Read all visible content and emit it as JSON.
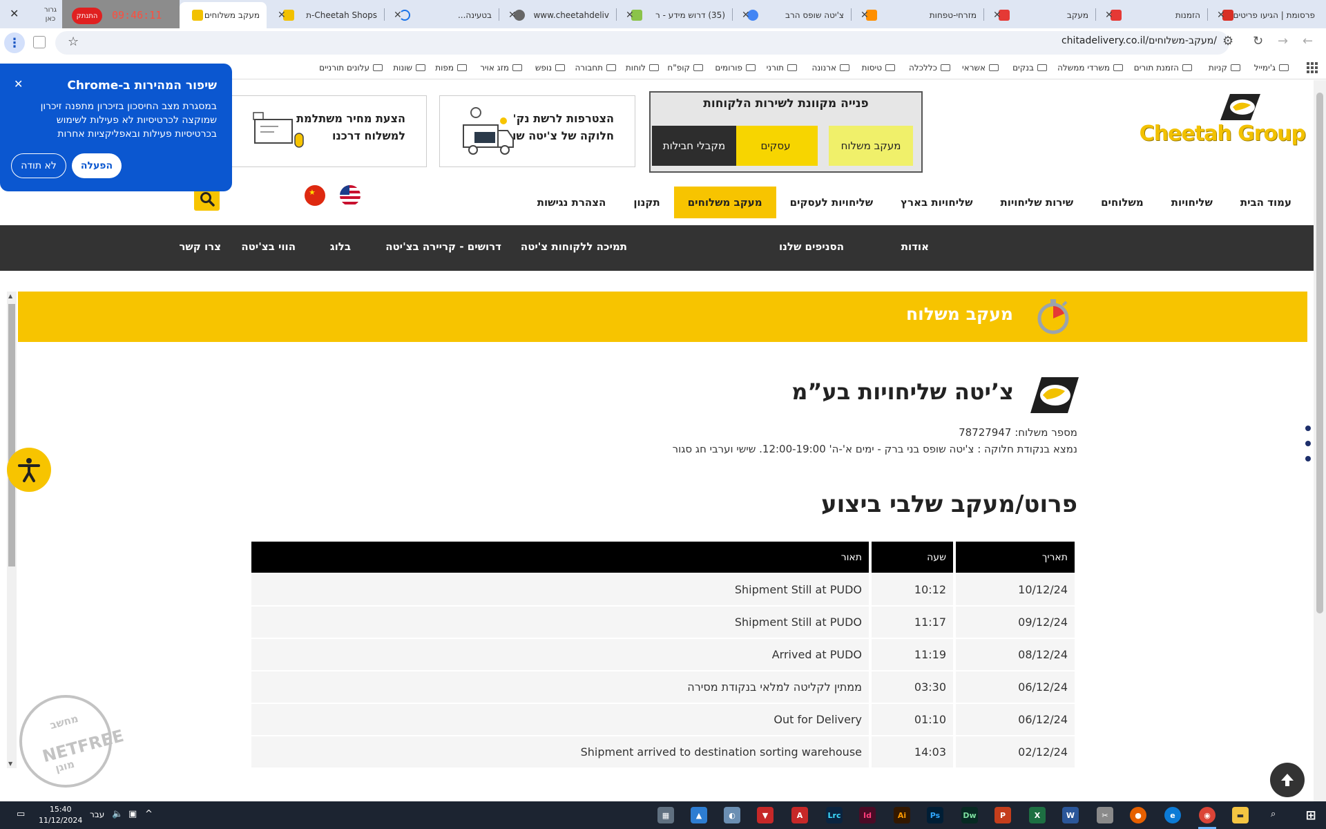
{
  "browser": {
    "tabs": [
      {
        "title": "פרסומת | הגיעו פריטים",
        "favicon_color": "#d93025",
        "favicon": "gmail-icon"
      },
      {
        "title": "הזמנות",
        "favicon_color": "#e53935",
        "favicon": "orders-icon"
      },
      {
        "title": "מעקב",
        "favicon_color": "#e53935",
        "favicon": "tracking-icon"
      },
      {
        "title": "מזרחי-טפחות",
        "favicon_color": "#ff8f00",
        "favicon": "bank-icon"
      },
      {
        "title": "צ'יטה שופס הרב",
        "favicon_color": "#4285f4",
        "favicon": "google-icon"
      },
      {
        "title": "(35) דרוש מידע - ר",
        "favicon_color": "#8bc34a",
        "favicon": "forum-icon"
      },
      {
        "title": "www.cheetahdeliv",
        "favicon_color": "#666666",
        "favicon": "globe-icon"
      },
      {
        "title": "בטעינה...",
        "favicon_color": "#1a73e8",
        "favicon": "loading-icon"
      },
      {
        "title": "Cheetah Shops-ת",
        "favicon_color": "#f2c100",
        "favicon": "cheetah-icon"
      },
      {
        "title": "מעקב משלוחים -",
        "favicon_color": "#f2c100",
        "favicon": "cheetah-icon",
        "active": true
      }
    ],
    "recorder": {
      "time": "09:46:11",
      "stop_label": "התנתק",
      "side_label": "גרור כאן"
    },
    "url": "chitadelivery.co.il/מעקב-משלוחים/",
    "bookmarks": [
      "ג'ימייל",
      "קניות",
      "הזמנת תורים",
      "משרדי ממשלה",
      "בנקים",
      "אשראי",
      "כללכלה",
      "טיסות",
      "ארנונה",
      "תורני",
      "פורומים",
      "קופ\"ח",
      "לוחות",
      "תחבורה",
      "נופש",
      "מזג אויר",
      "מפות",
      "שונות",
      "עלונים תורניים"
    ]
  },
  "chrome_bubble": {
    "title": "שיפור המהירות ב-Chrome",
    "body": "במסגרת מצב החיסכון בזיכרון מתפנה זיכרון שמוקצה לכרטיסיות לא פעילות לשימוש בכרטיסיות פעילות ובאפליקציות אחרות",
    "enable_label": "הפעלה",
    "decline_label": "לא תודה"
  },
  "site": {
    "logo_text": "Cheetah Group",
    "customer_service": {
      "title": "פנייה מקוונת לשירות הלקוחות",
      "buttons": [
        "מעקב משלוח",
        "עסקים",
        "מקבלי חבילות"
      ]
    },
    "promos": [
      {
        "line1": "הצטרפות לרשת נק'",
        "line2": "חלוקה של צ'יטה שופס"
      },
      {
        "line1": "הצעת מחיר משתלמת",
        "line2": "למשלוח דרכנו"
      }
    ],
    "main_nav": [
      "עמוד הבית",
      "שליחויות",
      "משלוחים",
      "שירות שליחויות",
      "שליחויות בארץ",
      "שליחויות לעסקים",
      "מעקב משלוחים",
      "תקנון",
      "הצהרת נגישות"
    ],
    "main_nav_active": "מעקב משלוחים",
    "secondary_nav": [
      "אודות",
      "הסניפים שלנו",
      "תמיכה ללקוחות צ'יטה",
      "דרושים - קריירה בצ'יטה",
      "בלוג",
      "הווי בצ'יטה",
      "צרו קשר"
    ],
    "banner_title": "מעקב משלוח"
  },
  "tracking": {
    "company": "צ’יטה שליחויות בע”מ",
    "shipment_number_line": "מספר משלוח: 78727947",
    "location_line": "נמצא בנקודת חלוקה : צ'יטה שופס בני ברק - ימים א'-ה' 12:00-19:00. שישי וערבי חג סגור",
    "section_title": "פרוט/מעקב שלבי ביצוע",
    "headers": {
      "date": "תאריך",
      "time": "שעה",
      "description": "תאור"
    },
    "rows": [
      {
        "date": "10/12/24",
        "time": "10:12",
        "description": "Shipment Still at PUDO"
      },
      {
        "date": "09/12/24",
        "time": "11:17",
        "description": "Shipment Still at PUDO"
      },
      {
        "date": "08/12/24",
        "time": "11:19",
        "description": "Arrived at PUDO"
      },
      {
        "date": "06/12/24",
        "time": "03:30",
        "description": "ממתין לקליטה למלאי בנקודת מסירה"
      },
      {
        "date": "06/12/24",
        "time": "01:10",
        "description": "Out for Delivery"
      },
      {
        "date": "02/12/24",
        "time": "14:03",
        "description": "Shipment arrived to destination sorting warehouse"
      }
    ]
  },
  "watermark": {
    "top": "מחשב",
    "main": "NETFREE",
    "bottom": "מוגן"
  },
  "taskbar": {
    "time": "15:40",
    "date": "11/12/2024",
    "language": "עבר"
  },
  "colors": {
    "brand_yellow": "#f7c400",
    "dark_nav": "#333333",
    "chrome_blue": "#0b57d0"
  }
}
